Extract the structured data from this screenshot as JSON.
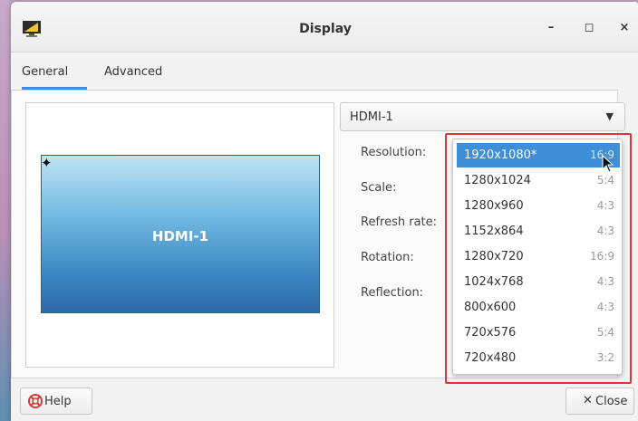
{
  "window": {
    "title": "Display",
    "minimize_label": "–",
    "maximize_label": "◻",
    "close_label": "×"
  },
  "tabs": [
    {
      "label": "General",
      "active": true
    },
    {
      "label": "Advanced",
      "active": false
    }
  ],
  "preview": {
    "monitor_label": "HDMI-1",
    "primary_marker": "✦"
  },
  "output_select": {
    "value": "HDMI-1",
    "arrow": "▼"
  },
  "properties": {
    "resolution_label": "Resolution:",
    "scale_label": "Scale:",
    "refresh_label": "Refresh rate:",
    "rotation_label": "Rotation:",
    "reflection_label": "Reflection:"
  },
  "resolution_options": [
    {
      "resolution": "1920x1080*",
      "ratio": "16:9",
      "selected": true
    },
    {
      "resolution": "1280x1024",
      "ratio": "5:4"
    },
    {
      "resolution": "1280x960",
      "ratio": "4:3"
    },
    {
      "resolution": "1152x864",
      "ratio": "4:3"
    },
    {
      "resolution": "1280x720",
      "ratio": "16:9"
    },
    {
      "resolution": "1024x768",
      "ratio": "4:3"
    },
    {
      "resolution": "800x600",
      "ratio": "4:3"
    },
    {
      "resolution": "720x576",
      "ratio": "5:4"
    },
    {
      "resolution": "720x480",
      "ratio": "3:2"
    }
  ],
  "footer": {
    "help_label": "Help",
    "close_label": "Close",
    "close_icon": "✕"
  },
  "colors": {
    "accent": "#3e8fd8",
    "highlight_frame": "#d9373b"
  }
}
